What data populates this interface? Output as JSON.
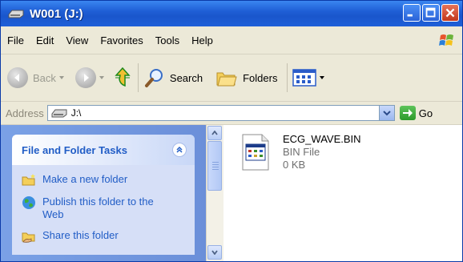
{
  "window": {
    "title": "W001 (J:)",
    "title_icon": "drive-icon"
  },
  "menu": [
    "File",
    "Edit",
    "View",
    "Favorites",
    "Tools",
    "Help"
  ],
  "toolbar": {
    "back_label": "Back",
    "search_label": "Search",
    "folders_label": "Folders"
  },
  "address": {
    "label": "Address",
    "value": "J:\\",
    "go_label": "Go"
  },
  "tasks": {
    "title": "File and Folder Tasks",
    "items": [
      {
        "label": "Make a new folder",
        "icon": "new-folder-icon"
      },
      {
        "label": "Publish this folder to the Web",
        "icon": "publish-web-icon"
      },
      {
        "label": "Share this folder",
        "icon": "share-folder-icon"
      }
    ]
  },
  "file": {
    "name": "ECG_WAVE.BIN",
    "type": "BIN File",
    "size": "0 KB"
  },
  "colors": {
    "title_bar": "#1f5fd6",
    "task_link": "#215dc6",
    "task_pane": "#7aa1e6"
  }
}
